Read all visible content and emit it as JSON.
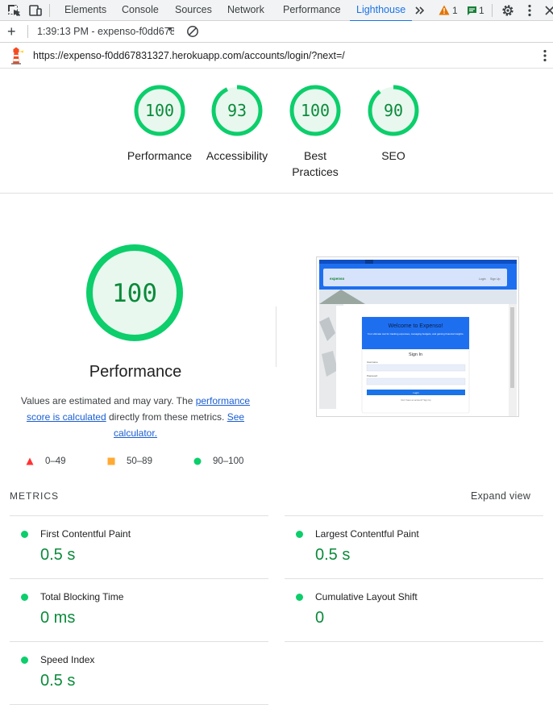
{
  "devtools": {
    "tabs": [
      {
        "label": "Elements",
        "active": false
      },
      {
        "label": "Console",
        "active": false
      },
      {
        "label": "Sources",
        "active": false
      },
      {
        "label": "Network",
        "active": false
      },
      {
        "label": "Performance",
        "active": false
      },
      {
        "label": "Lighthouse",
        "active": true
      }
    ],
    "warnings_count": "1",
    "messages_count": "1",
    "icons": [
      "inspect-icon",
      "device-toolbar-icon",
      "more-tabs-icon",
      "warning-icon",
      "message-icon",
      "settings-icon",
      "kebab-icon",
      "close-icon"
    ]
  },
  "toolbar": {
    "add": "+",
    "report": "1:39:13 PM - expenso-f0dd678",
    "caret": "▾",
    "clear_icon": "clear-icon"
  },
  "url_bar": {
    "url": "https://expenso-f0dd67831327.herokuapp.com/accounts/login/?next=/"
  },
  "gauges": [
    {
      "score": "100",
      "label": "Performance",
      "fraction": 1.0
    },
    {
      "score": "93",
      "label": "Accessibility",
      "fraction": 0.93
    },
    {
      "score": "100",
      "label": "Best\nPractices",
      "fraction": 1.0
    },
    {
      "score": "90",
      "label": "SEO",
      "fraction": 0.9
    }
  ],
  "performance": {
    "score": "100",
    "title": "Performance",
    "desc_prefix": "Values are estimated and may vary. The ",
    "link1": "performance score is calculated",
    "desc_middle": " directly from these metrics. ",
    "link2": "See calculator."
  },
  "legend": [
    {
      "range": "0–49",
      "shape": "triangle",
      "color": "#ff3333"
    },
    {
      "range": "50–89",
      "shape": "square",
      "color": "#ffaa33"
    },
    {
      "range": "90–100",
      "shape": "circle",
      "color": "#0cce6b"
    }
  ],
  "metrics": {
    "header": "METRICS",
    "expand": "Expand view",
    "items": [
      {
        "name": "First Contentful Paint",
        "value": "0.5 s"
      },
      {
        "name": "Largest Contentful Paint",
        "value": "0.5 s"
      },
      {
        "name": "Total Blocking Time",
        "value": "0 ms"
      },
      {
        "name": "Cumulative Layout Shift",
        "value": "0"
      },
      {
        "name": "Speed Index",
        "value": "0.5 s"
      }
    ]
  },
  "thumbnail": {
    "brand": "expenso",
    "nav_login": "Login",
    "nav_signup": "Sign Up",
    "welcome": "Welcome to Expenso!",
    "tagline": "Your ultimate tool for tracking expenses, managing budgets, and gaining financial insights.",
    "sign_in": "Sign In",
    "username_label": "Username",
    "password_label": "Password",
    "login_button": "Login",
    "signup_link": "Don't have an account? Sign Up"
  },
  "colors": {
    "pass": "#0cce6b",
    "pass_text": "#0b8a3b",
    "pass_bg": "#e8f8ee",
    "accent": "#1a73e8"
  }
}
